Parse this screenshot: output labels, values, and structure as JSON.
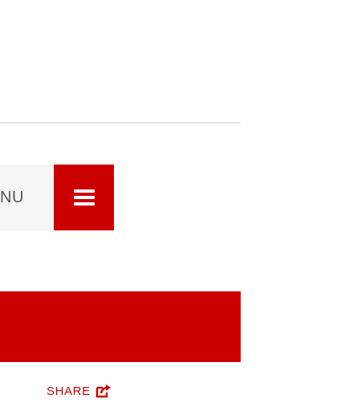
{
  "header": {
    "menu_label": "NU",
    "menu_icon": "hamburger-icon"
  },
  "share": {
    "label": "SHARE",
    "icon": "share-icon"
  },
  "colors": {
    "accent": "#cc0000",
    "menu_background": "#f5f5f5",
    "divider": "#e6e6e6",
    "text_gray": "#555555"
  }
}
